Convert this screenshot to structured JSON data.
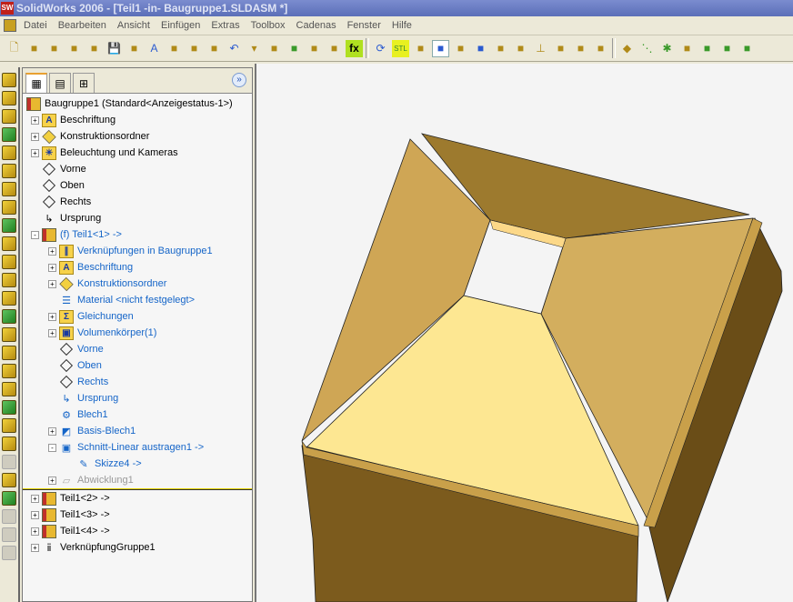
{
  "window": {
    "title": "SolidWorks 2006 - [Teil1 -in- Baugruppe1.SLDASM *]",
    "logo": "SW"
  },
  "menu": [
    "Datei",
    "Bearbeiten",
    "Ansicht",
    "Einfügen",
    "Extras",
    "Toolbox",
    "Cadenas",
    "Fenster",
    "Hilfe"
  ],
  "toolbar": [
    "new-icon",
    "open-icon",
    "assembly-icon",
    "folder-icon",
    "copy-icon",
    "save-icon",
    "rebuild-icon",
    "text-icon",
    "note-icon",
    "component-icon",
    "print-preview-icon",
    "undo-icon",
    "dropdown-icon",
    "select-icon",
    "lasso-icon",
    "traffic-light-icon",
    "palette-icon",
    "fx-icon",
    "sep",
    "refresh-icon",
    "stl-icon",
    "wireframe-icon",
    "shaded-icon",
    "section-icon",
    "cube-icon",
    "light-icon",
    "gears-icon",
    "origin-icon",
    "measure-icon",
    "balance-icon",
    "properties-icon",
    "sep",
    "plane-icon",
    "axis-icon",
    "point-icon",
    "mate-icon",
    "user-icon",
    "user-icon",
    "user-icon"
  ],
  "tree": {
    "root": "Baugruppe1  (Standard<Anzeigestatus-1>)",
    "items": [
      {
        "label": "Beschriftung",
        "level": 1,
        "exp": "+",
        "icon": "annotation",
        "style": "black"
      },
      {
        "label": "Konstruktionsordner",
        "level": 1,
        "exp": "+",
        "icon": "design",
        "style": "black"
      },
      {
        "label": "Beleuchtung und Kameras",
        "level": 1,
        "exp": "+",
        "icon": "light",
        "style": "black"
      },
      {
        "label": "Vorne",
        "level": 1,
        "exp": "",
        "icon": "plane",
        "style": "black"
      },
      {
        "label": "Oben",
        "level": 1,
        "exp": "",
        "icon": "plane",
        "style": "black"
      },
      {
        "label": "Rechts",
        "level": 1,
        "exp": "",
        "icon": "plane",
        "style": "black"
      },
      {
        "label": "Ursprung",
        "level": 1,
        "exp": "",
        "icon": "origin",
        "style": "black"
      },
      {
        "label": "(f) Teil1<1> ->",
        "level": 1,
        "exp": "-",
        "icon": "part",
        "style": "blue"
      },
      {
        "label": "Verknüpfungen in Baugruppe1",
        "level": 2,
        "exp": "+",
        "icon": "mates",
        "style": "blue"
      },
      {
        "label": "Beschriftung",
        "level": 2,
        "exp": "+",
        "icon": "annotation",
        "style": "blue"
      },
      {
        "label": "Konstruktionsordner",
        "level": 2,
        "exp": "+",
        "icon": "design",
        "style": "blue"
      },
      {
        "label": "Material <nicht festgelegt>",
        "level": 2,
        "exp": "",
        "icon": "material",
        "style": "blue"
      },
      {
        "label": "Gleichungen",
        "level": 2,
        "exp": "+",
        "icon": "equations",
        "style": "blue"
      },
      {
        "label": "Volumenkörper(1)",
        "level": 2,
        "exp": "+",
        "icon": "solid",
        "style": "blue"
      },
      {
        "label": "Vorne",
        "level": 2,
        "exp": "",
        "icon": "plane",
        "style": "blue"
      },
      {
        "label": "Oben",
        "level": 2,
        "exp": "",
        "icon": "plane",
        "style": "blue"
      },
      {
        "label": "Rechts",
        "level": 2,
        "exp": "",
        "icon": "plane",
        "style": "blue"
      },
      {
        "label": "Ursprung",
        "level": 2,
        "exp": "",
        "icon": "origin",
        "style": "blue"
      },
      {
        "label": "Blech1",
        "level": 2,
        "exp": "",
        "icon": "sheetmetal",
        "style": "blue"
      },
      {
        "label": "Basis-Blech1",
        "level": 2,
        "exp": "+",
        "icon": "baseflange",
        "style": "blue"
      },
      {
        "label": "Schnitt-Linear austragen1 ->",
        "level": 2,
        "exp": "-",
        "icon": "cut",
        "style": "blue"
      },
      {
        "label": "Skizze4 ->",
        "level": 3,
        "exp": "",
        "icon": "sketch",
        "style": "blue"
      },
      {
        "label": "Abwicklung1",
        "level": 2,
        "exp": "+",
        "icon": "flatten",
        "style": "gray"
      },
      {
        "label": "Teil1<2> ->",
        "level": 1,
        "exp": "+",
        "icon": "part",
        "style": "black"
      },
      {
        "label": "Teil1<3> ->",
        "level": 1,
        "exp": "+",
        "icon": "part",
        "style": "black"
      },
      {
        "label": "Teil1<4> ->",
        "level": 1,
        "exp": "+",
        "icon": "part",
        "style": "black"
      },
      {
        "label": "VerknüpfungGruppe1",
        "level": 1,
        "exp": "+",
        "icon": "mategroup",
        "style": "black"
      }
    ]
  },
  "colors": {
    "back_wall": "#9d7a2e",
    "left_wall": "#cfa655",
    "right_wall": "#d3ae5e",
    "floor": "#fde792",
    "front_face": "#7c5b1d",
    "right_face": "#6a4d17",
    "rim": "#c9a04a"
  }
}
